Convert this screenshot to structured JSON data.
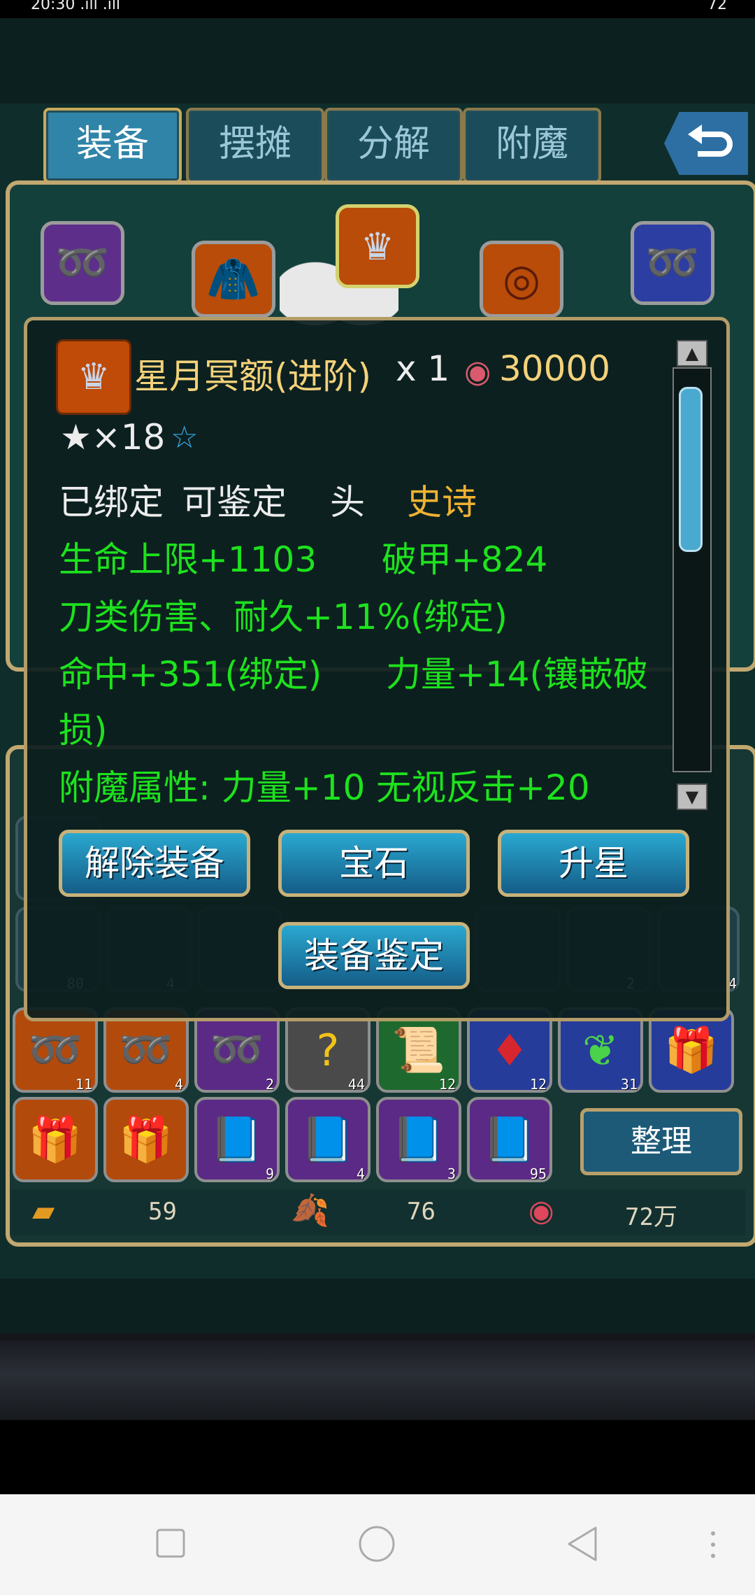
{
  "status_bar": {
    "time": "20:30 .ıll .ıll",
    "battery": "72"
  },
  "tabs": [
    {
      "label": "装备",
      "active": true
    },
    {
      "label": "摆摊",
      "active": false
    },
    {
      "label": "分解",
      "active": false
    },
    {
      "label": "附魔",
      "active": false
    }
  ],
  "item_popup": {
    "name": "星月冥额(进阶)",
    "quantity": "x 1",
    "price": "30000",
    "stars": "★×18",
    "status_line": [
      "已绑定",
      "可鉴定",
      "头",
      "史诗"
    ],
    "attributes": [
      "生命上限+1103",
      "破甲+824",
      "刀类伤害、耐久+11%(绑定)",
      "命中+351(绑定)",
      "力量+14(镶嵌破",
      "损)",
      "附魔属性: 力量+10 无视反击+20"
    ],
    "buttons": {
      "unequip": "解除装备",
      "gem": "宝石",
      "upgrade_star": "升星",
      "identify": "装备鉴定"
    }
  },
  "inventory": {
    "row_counts_bg": [
      "80",
      "4",
      "2",
      "4"
    ],
    "row1": [
      {
        "icon": "necklace-icon",
        "count": "11",
        "color": "orange"
      },
      {
        "icon": "necklace-icon",
        "count": "4",
        "color": "orange"
      },
      {
        "icon": "necklace-icon",
        "count": "2",
        "color": "purple"
      },
      {
        "icon": "question-icon",
        "count": "44",
        "color": "gray"
      },
      {
        "icon": "scroll-icon",
        "count": "12",
        "color": "green"
      },
      {
        "icon": "gem-icon",
        "count": "12",
        "color": "blue"
      },
      {
        "icon": "leaf-icon",
        "count": "31",
        "color": "blue"
      },
      {
        "icon": "gift-icon",
        "count": "",
        "color": "blue"
      }
    ],
    "row2": [
      {
        "icon": "gift-icon",
        "count": "",
        "color": "orange"
      },
      {
        "icon": "gift-icon",
        "count": "",
        "color": "orange"
      },
      {
        "icon": "book-icon",
        "count": "9",
        "color": "purple"
      },
      {
        "icon": "book-icon",
        "count": "4",
        "color": "purple"
      },
      {
        "icon": "book-icon",
        "count": "3",
        "color": "purple"
      },
      {
        "icon": "book-icon",
        "count": "95",
        "color": "purple"
      }
    ],
    "sort_button": "整理"
  },
  "currency": {
    "gold_bar": "59",
    "leaf": "76",
    "coin": "72万"
  }
}
